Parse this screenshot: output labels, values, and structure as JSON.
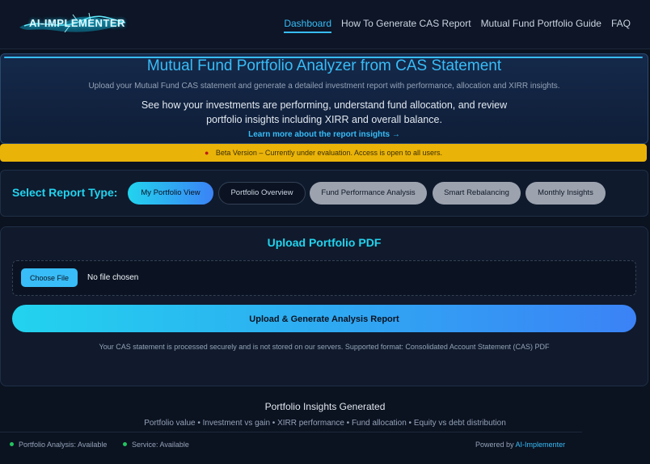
{
  "nav": {
    "logo": "AI-IMPLEMENTER",
    "links": [
      "Dashboard",
      "How To Generate CAS Report",
      "Mutual Fund Portfolio Guide",
      "FAQ"
    ]
  },
  "hero": {
    "title": "Mutual Fund Portfolio Analyzer from CAS Statement",
    "subtitle": "Upload your Mutual Fund CAS statement and generate a detailed investment report with performance, allocation and XIRR insights.",
    "description": "See how your investments are performing, understand fund allocation, and review portfolio insights including XIRR and overall balance.",
    "link": "Learn more about the report insights →"
  },
  "beta": {
    "text": "Beta Version – Currently under evaluation. Access is open to all users."
  },
  "report_type": {
    "label": "Select Report Type:",
    "options": [
      "My Portfolio View",
      "Portfolio Overview",
      "Fund Performance Analysis",
      "Smart Rebalancing",
      "Monthly Insights"
    ]
  },
  "upload": {
    "title": "Upload Portfolio PDF",
    "choose_label": "Choose File",
    "file_status": "No file chosen",
    "submit_label": "Upload & Generate Analysis Report",
    "note": "Your CAS statement is processed securely and is not stored on our servers. Supported format: Consolidated Account Statement (CAS) PDF"
  },
  "insights": {
    "title": "Portfolio Insights Generated",
    "items": "Portfolio value • Investment vs gain • XIRR performance • Fund allocation • Equity vs debt distribution"
  },
  "footer": {
    "status1": "Portfolio Analysis: Available",
    "status2": "Service: Available",
    "powered_prefix": "Powered by",
    "powered_brand": "AI-Implementer"
  },
  "colors": {
    "accent": "#38bdf8",
    "accent_teal": "#22d3ee",
    "beta_banner": "#eab308",
    "status_ok": "#22c55e"
  },
  "icons": [
    "logo-splash-icon",
    "status-dot-icon"
  ]
}
